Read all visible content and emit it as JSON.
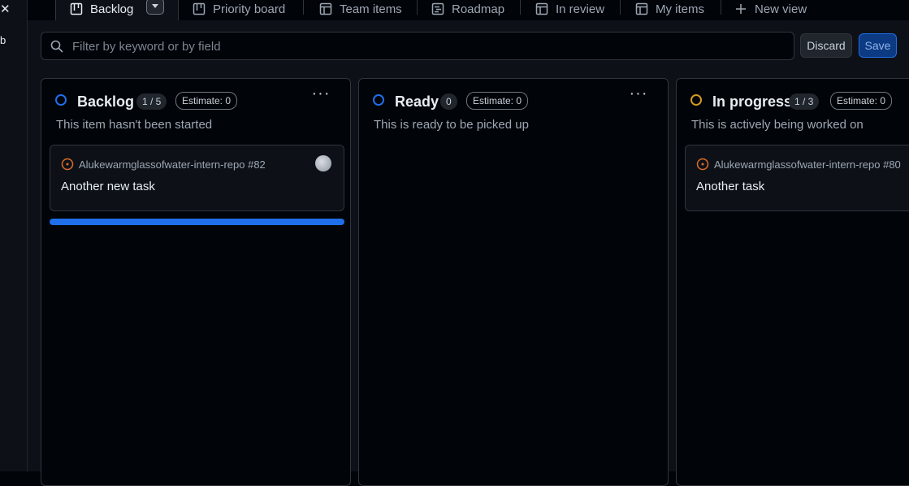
{
  "sidebar": {
    "close_glyph": "✕",
    "partial_label": "b"
  },
  "tabs": [
    {
      "label": "Backlog",
      "icon": "board-icon"
    },
    {
      "label": "Priority board",
      "icon": "board-icon"
    },
    {
      "label": "Team items",
      "icon": "table-icon"
    },
    {
      "label": "Roadmap",
      "icon": "roadmap-icon"
    },
    {
      "label": "In review",
      "icon": "table-icon"
    },
    {
      "label": "My items",
      "icon": "table-icon"
    },
    {
      "label": "New view",
      "icon": "plus-icon"
    }
  ],
  "filter": {
    "placeholder": "Filter by keyword or by field",
    "value": ""
  },
  "actions": {
    "discard": "Discard",
    "save": "Save"
  },
  "columns": [
    {
      "title": "Backlog",
      "count": "1 / 5",
      "estimate": "Estimate: 0",
      "description": "This item hasn't been started",
      "status_color": "#1f6feb",
      "cards": [
        {
          "repo": "Alukewarmglassofwater-intern-repo #82",
          "title": "Another new task"
        }
      ]
    },
    {
      "title": "Ready",
      "count": "0",
      "estimate": "Estimate: 0",
      "description": "This is ready to be picked up",
      "status_color": "#1f6feb",
      "cards": []
    },
    {
      "title": "In progress",
      "count": "1 / 3",
      "estimate": "Estimate: 0",
      "description": "This is actively being worked on",
      "status_color": "#d29922",
      "cards": [
        {
          "repo": "Alukewarmglassofwater-intern-repo #80",
          "title": "Another task"
        }
      ]
    }
  ],
  "colors": {
    "accent": "#1f6feb",
    "issue_open": "#db6d28",
    "in_progress": "#d29922"
  }
}
